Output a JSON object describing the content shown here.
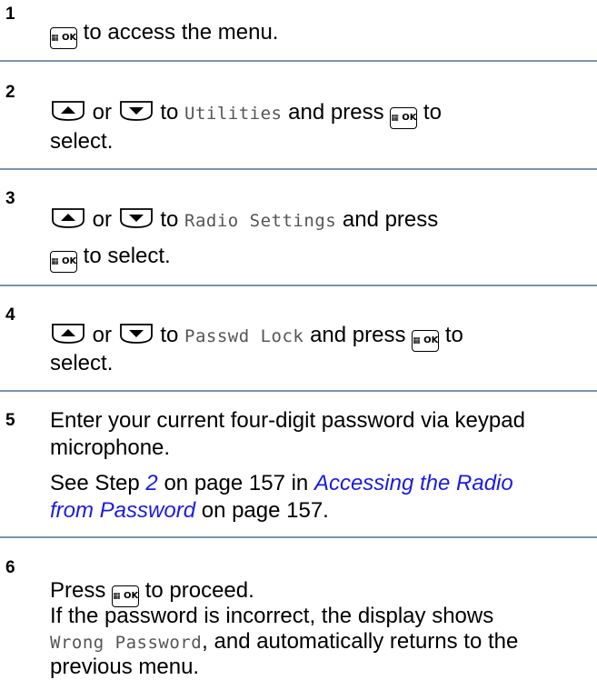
{
  "steps": [
    {
      "number": "1",
      "text1": "to access the menu."
    },
    {
      "number": "2",
      "or": "or",
      "to": "to",
      "mono": "Utilities",
      "and_press": "and press",
      "to_end": "to",
      "line2": "select."
    },
    {
      "number": "3",
      "or": "or",
      "to": "to",
      "mono": "Radio Settings",
      "and_press": "and press",
      "line2": "to select."
    },
    {
      "number": "4",
      "or": "or",
      "to": "to",
      "mono": "Passwd Lock",
      "and_press": "and press",
      "to_end": "to",
      "line2": "select."
    },
    {
      "number": "5",
      "line1": "Enter your current four-digit password via keypad",
      "line2": "microphone.",
      "see": "See Step",
      "step_ref": "2",
      "on_page_a": "on page 157 in",
      "link_a": "Accessing the Radio",
      "link_b": "from Password",
      "on_page_b": "on page 157."
    },
    {
      "number": "6",
      "press": "Press",
      "proceed": "to proceed.",
      "line2": "If the password is incorrect, the display shows",
      "mono": "Wrong Password",
      "line3_rest": ", and automatically returns to the",
      "line4": "previous menu."
    }
  ],
  "icons": {
    "ok_key": "menu-ok-key-icon",
    "up_key": "up-arrow-key-icon",
    "down_key": "down-arrow-key-icon"
  },
  "ok_key_text": "OK",
  "ok_key_grid": "▦",
  "colors": {
    "separator": "#7b93ad",
    "link": "#1a1ae6",
    "mono_text": "#555555"
  }
}
